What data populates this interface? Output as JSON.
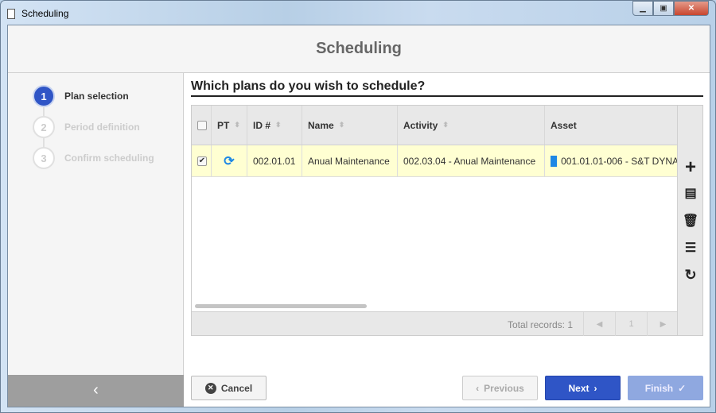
{
  "window": {
    "title": "Scheduling"
  },
  "header": {
    "title": "Scheduling"
  },
  "steps": [
    {
      "num": "1",
      "label": "Plan selection"
    },
    {
      "num": "2",
      "label": "Period definition"
    },
    {
      "num": "3",
      "label": "Confirm scheduling"
    }
  ],
  "main": {
    "title": "Which plans do you wish to schedule?"
  },
  "grid": {
    "columns": [
      "PT",
      "ID #",
      "Name",
      "Activity",
      "Asset"
    ],
    "rows": [
      {
        "checked": true,
        "pt_icon": "maintenance-cycle-icon",
        "id": "002.01.01",
        "name": "Anual Maintenance",
        "activity": "002.03.04 - Anual Maintenance",
        "asset": "001.01.01-006 - S&T DYNA"
      }
    ],
    "total_label": "Total records: 1",
    "page": "1"
  },
  "buttons": {
    "cancel": "Cancel",
    "previous": "Previous",
    "next": "Next",
    "finish": "Finish"
  },
  "colors": {
    "accent": "#2f55c6",
    "row_selected": "#ffffd2"
  }
}
